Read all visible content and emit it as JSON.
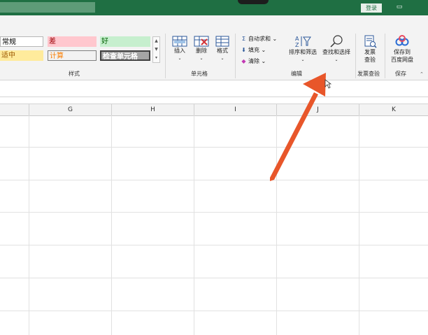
{
  "titlebar": {
    "login_label": "登录"
  },
  "styles": {
    "cells": [
      {
        "label": "常规"
      },
      {
        "label": "差"
      },
      {
        "label": "好"
      },
      {
        "label": "适中"
      },
      {
        "label": "计算"
      },
      {
        "label": "检查单元格"
      }
    ],
    "group_label": "样式"
  },
  "cells_group": {
    "insert": "插入",
    "delete": "删除",
    "format": "格式",
    "group_label": "单元格"
  },
  "editing": {
    "autosum": "自动求和",
    "fill": "填充",
    "clear": "清除",
    "sort_filter": "排序和筛选",
    "find_select": "查找和选择",
    "group_label": "编辑"
  },
  "invoice": {
    "line1": "发票",
    "line2": "查验",
    "group_label": "发票查验"
  },
  "save": {
    "line1": "保存到",
    "line2": "百度网盘",
    "group_label": "保存"
  },
  "columns": [
    "G",
    "H",
    "I",
    "J",
    "K"
  ],
  "colors": {
    "titlebar": "#1f6f43",
    "arrow": "#e8562a"
  },
  "icons": [
    "sigma-icon",
    "fill-down-icon",
    "eraser-icon",
    "sort-filter-icon",
    "magnifier-icon",
    "invoice-icon",
    "cloud-save-icon"
  ]
}
